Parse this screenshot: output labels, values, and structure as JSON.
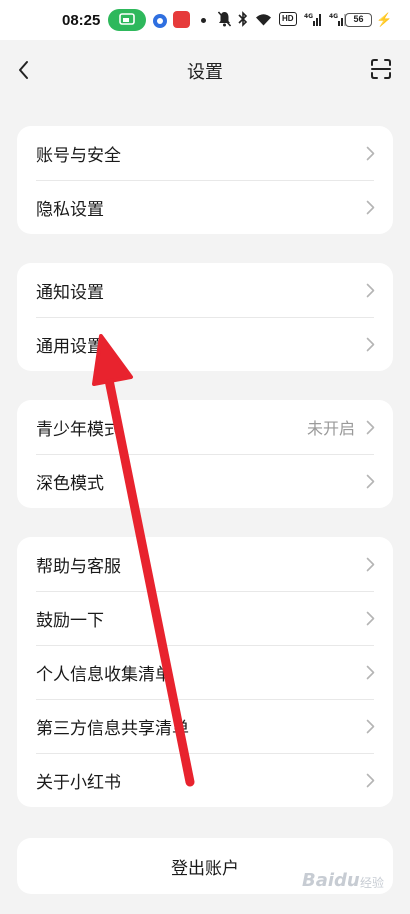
{
  "status_bar": {
    "time": "08:25",
    "battery": "56",
    "network_tags": [
      "HD",
      "4G",
      "4G"
    ],
    "icons": [
      "screen-cast-icon",
      "app-notification-icon",
      "app-notification-icon-2",
      "dot-icon",
      "mute-bell-icon",
      "bluetooth-icon",
      "wifi-icon",
      "signal-icon",
      "signal-icon-2",
      "battery-icon",
      "charging-icon"
    ]
  },
  "header": {
    "title": "设置",
    "back_icon": "chevron-left-icon",
    "right_icon": "scan-icon"
  },
  "groups": [
    {
      "items": [
        {
          "label": "账号与安全"
        },
        {
          "label": "隐私设置"
        }
      ]
    },
    {
      "items": [
        {
          "label": "通知设置"
        },
        {
          "label": "通用设置"
        }
      ]
    },
    {
      "items": [
        {
          "label": "青少年模式",
          "value": "未开启"
        },
        {
          "label": "深色模式"
        }
      ]
    },
    {
      "items": [
        {
          "label": "帮助与客服"
        },
        {
          "label": "鼓励一下"
        },
        {
          "label": "个人信息收集清单"
        },
        {
          "label": "第三方信息共享清单"
        },
        {
          "label": "关于小红书"
        }
      ]
    }
  ],
  "logout_label": "登出账户",
  "annotation": {
    "color": "#e8232e",
    "shape": "arrow-pointing-to-general-settings"
  },
  "watermark": {
    "text": "Baidu",
    "sub": "经验"
  },
  "colors": {
    "background": "#f3f3f3",
    "card": "#ffffff",
    "secondary_text": "#9a9a9a"
  }
}
